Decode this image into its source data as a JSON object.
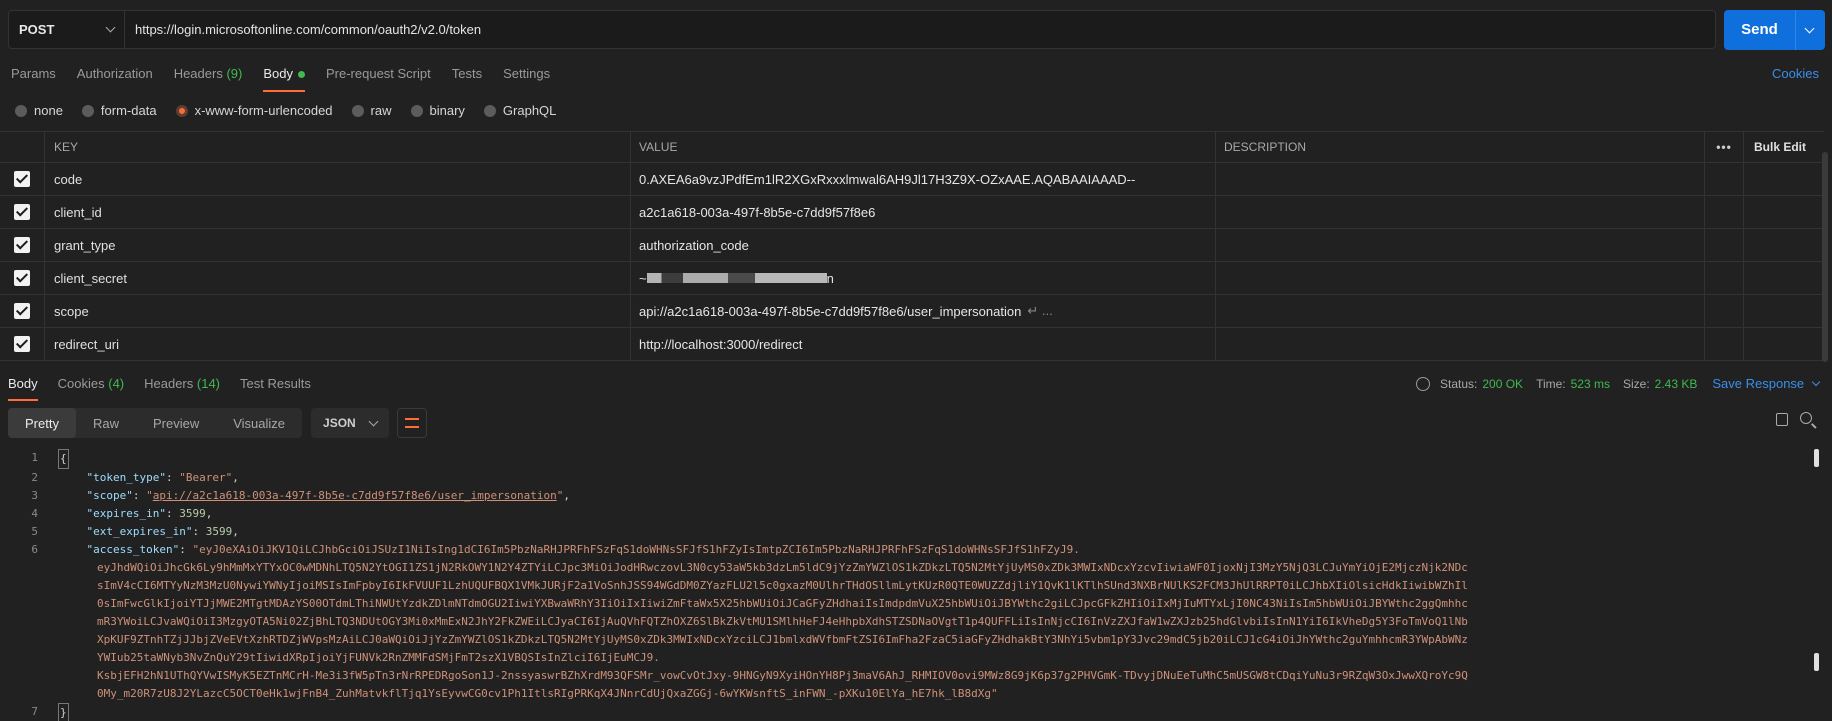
{
  "request": {
    "method": "POST",
    "url": "https://login.microsoftonline.com/common/oauth2/v2.0/token",
    "send_label": "Send"
  },
  "tabs": [
    {
      "label": "Params"
    },
    {
      "label": "Authorization"
    },
    {
      "label": "Headers",
      "count": "(9)"
    },
    {
      "label": "Body",
      "active": true
    },
    {
      "label": "Pre-request Script"
    },
    {
      "label": "Tests"
    },
    {
      "label": "Settings"
    }
  ],
  "cookies_label": "Cookies",
  "body_types": [
    "none",
    "form-data",
    "x-www-form-urlencoded",
    "raw",
    "binary",
    "GraphQL"
  ],
  "selected_body_type": "x-www-form-urlencoded",
  "kv_table": {
    "headers": {
      "key": "KEY",
      "value": "VALUE",
      "description": "DESCRIPTION",
      "more": "•••",
      "bulk_edit": "Bulk Edit"
    },
    "rows": [
      {
        "key": "code",
        "value": "0.AXEA6a9vzJPdfEm1lR2XGxRxxxlmwal6AH9Jl17H3Z9X-OZxAAE.AQABAAIAAAD--"
      },
      {
        "key": "client_id",
        "value": "a2c1a618-003a-497f-8b5e-c7dd9f57f8e6"
      },
      {
        "key": "grant_type",
        "value": "authorization_code"
      },
      {
        "key": "client_secret",
        "value_prefix": "~",
        "value_suffix": "n"
      },
      {
        "key": "scope",
        "value": "api://a2c1a618-003a-497f-8b5e-c7dd9f57f8e6/user_impersonation",
        "overflow": "↵ ..."
      },
      {
        "key": "redirect_uri",
        "value": "http://localhost:3000/redirect"
      }
    ]
  },
  "response": {
    "tabs": [
      {
        "label": "Body",
        "active": true
      },
      {
        "label": "Cookies",
        "count": "(4)"
      },
      {
        "label": "Headers",
        "count": "(14)"
      },
      {
        "label": "Test Results"
      }
    ],
    "status_label": "Status:",
    "status_value": "200 OK",
    "time_label": "Time:",
    "time_value": "523 ms",
    "size_label": "Size:",
    "size_value": "2.43 KB",
    "save_label": "Save Response",
    "format_tabs": [
      "Pretty",
      "Raw",
      "Preview",
      "Visualize"
    ],
    "format_selected": "Pretty",
    "language": "JSON",
    "body": {
      "open": "{",
      "close": "}",
      "token_type_key": "\"token_type\"",
      "token_type_val": "\"Bearer\"",
      "scope_key": "\"scope\"",
      "scope_val": "api://a2c1a618-003a-497f-8b5e-c7dd9f57f8e6/user_impersonation",
      "expires_key": "\"expires_in\"",
      "expires_val": "3599",
      "ext_expires_key": "\"ext_expires_in\"",
      "ext_expires_val": "3599",
      "access_token_key": "\"access_token\"",
      "access_token_lines": [
        "\"eyJ0eXAiOiJKV1QiLCJhbGciOiJSUzI1NiIsIng1dCI6Im5PbzNaRHJPRFhFSzFqS1doWHNsSFJfS1hFZyIsImtpZCI6Im5PbzNaRHJPRFhFSzFqS1doWHNsSFJfS1hFZyJ9.",
        "eyJhdWQiOiJhcGk6Ly9hMmMxYTYxOC0wMDNhLTQ5N2YtOGI1ZS1jN2RkOWY1N2Y4ZTYiLCJpc3MiOiJodHRwczovL3N0cy53aW5kb3dzLm5ldC9jYzZmYWZlOS1kZDkzLTQ5N2MtYjUyMS0xZDk3MWIxNDcxYzcvIiwiaWF0IjoxNjI3MzY5NjQ3LCJuYmYiOjE2MjczNjk2NDcsImV4cCI6MTYyNzM3MzU0NywiYWNyIjoiMSIsImFpbyI6IkFVUUF1LzhUQUFBQX1VMkJURjF2a1VoSnhJSS94WGdDM0ZYazFLU2l5c0gxazM0UlhrTHdOSllmLytKUzR0QTE0WUZZdjliY1QvK1lKTlhSUnd3NXBrNUlKS2FCM3JhUlRRPT0iLCJhbXIiOlsicHdkIiwibWZhIl0sImFwcGlkIjoiYTJjMWE2MTgtMDAzYS00OTdmLThiNWUtYzdkZDlmNTdmOGU2IiwiYXBwaWRhY3IiOiIxIiwiZmFtaWx5X25hbWUiOiJCaGFyZHdhaiIsImdpdmVuX25hbWUiOiJBYWthc2giLCJpcGFkZHIiOiIxMjIuMTYxLjI0NC43NiIsIm5hbWUiOiJBYWthc2ggQmhhcmR3YWoiLCJvaWQiOiI3MzgyOTA5Ni02ZjBhLTQ3NDUtOGY3Mi0xMmExN2JhY2FkZWEiLCJyaCI6IjAuQVhFQTZhOXZ6SlBkZkVtMU1SMlhHeFJ4eHhpbXdhSTZSDNaOVgtT1p4QUFFLiIsInNjcCI6InVzZXJfaW1wZXJzb25hdGlvbiIsInN1YiI6IkVheDg5Y3FoTmVoQ1lNbXpKUF9ZTnhTZjJJbjZVeEVtXzhRTDZjWVpsMzAiLCJ0aWQiOiJjYzZmYWZlOS1kZDkzLTQ5N2MtYjUyMS0xZDk3MWIxNDcxYzciLCJ1bmlxdWVfbmFtZSI6ImFha2FzaC5iaGFyZHdhakBtY3NhYi5vbm1pY3Jvc29mdC5jb20iLCJ1cG4iOiJhYWthc2guYmhhcmR3YWpAbWNzYWIub25taWNyb3NvZnQuY29tIiwidXRpIjoiYjFUNVk2RnZMMFdSMjFmT2szX1VBQSIsInZlciI6IjEuMCJ9.",
        "KsbjEFH2hN1UThQYVwISMyK5EZTnMCrH-Me3i3fW5pTn3rNrRPEDRgoSon1J-2nssyaswrBZhXrdM93QFSMr_vowCvOtJxy-9HNGyN9XyiHOnYH8Pj3maV6AhJ_RHMIOV0ovi9MWz8G9jK6p37g2PHVGmK-TDvyjDNuEeTuMhC5mUSGW8tCDqiYuNu3r9RZqW3OxJwwXQroYc9Q0My_m20R7zU8J2YLazcC5OCT0eHk1wjFnB4_ZuhMatvkflTjq1YsEyvwCG0cv1Ph1ItlsRIgPRKqX4JNnrCdUjQxaZGGj-6wYKWsnftS_inFWN_-pXKu10ElYa_hE7hk_lB8dXg\""
      ]
    }
  }
}
